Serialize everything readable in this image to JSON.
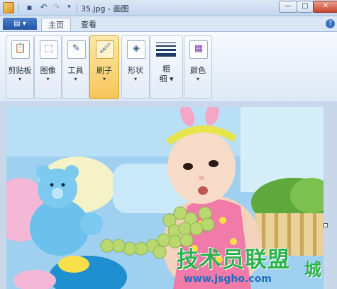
{
  "window": {
    "title": "35.jpg - 画图",
    "minimize_glyph": "—",
    "maximize_glyph": "□",
    "close_glyph": "✕"
  },
  "quick_access": {
    "save_glyph": "▪",
    "undo_glyph": "↶",
    "redo_glyph": "↷",
    "more_glyph": "▾"
  },
  "tabs": {
    "menu_glyph": "▤ ▾",
    "home": "主页",
    "view": "查看",
    "help_glyph": "?"
  },
  "ribbon": {
    "clipboard": {
      "label": "剪贴板",
      "icon": "clipboard-icon",
      "glyph": "📋"
    },
    "image": {
      "label": "图像",
      "icon": "select-icon",
      "glyph": "⬚"
    },
    "tools": {
      "label": "工具",
      "icon": "pencil-text-icon",
      "glyph": "✎"
    },
    "brushes": {
      "label": "刷子",
      "icon": "brush-icon",
      "glyph": "🖌"
    },
    "shapes": {
      "label": "形状",
      "icon": "shapes-icon",
      "glyph": "◈"
    },
    "size": {
      "label_line1": "粗",
      "label_line2": "细"
    },
    "colors": {
      "label": "颜色",
      "icon": "palette-icon",
      "glyph": "▦"
    },
    "dropdown_glyph": "▾"
  },
  "photo": {
    "watermark": "技术员联盟",
    "watermark_url": "www.jsgho.com",
    "watermark_suffix": "城"
  },
  "colors": {
    "accent": "#1f55a4",
    "brush_active": "#f8c659",
    "watermark_green": "#2bb24c"
  }
}
